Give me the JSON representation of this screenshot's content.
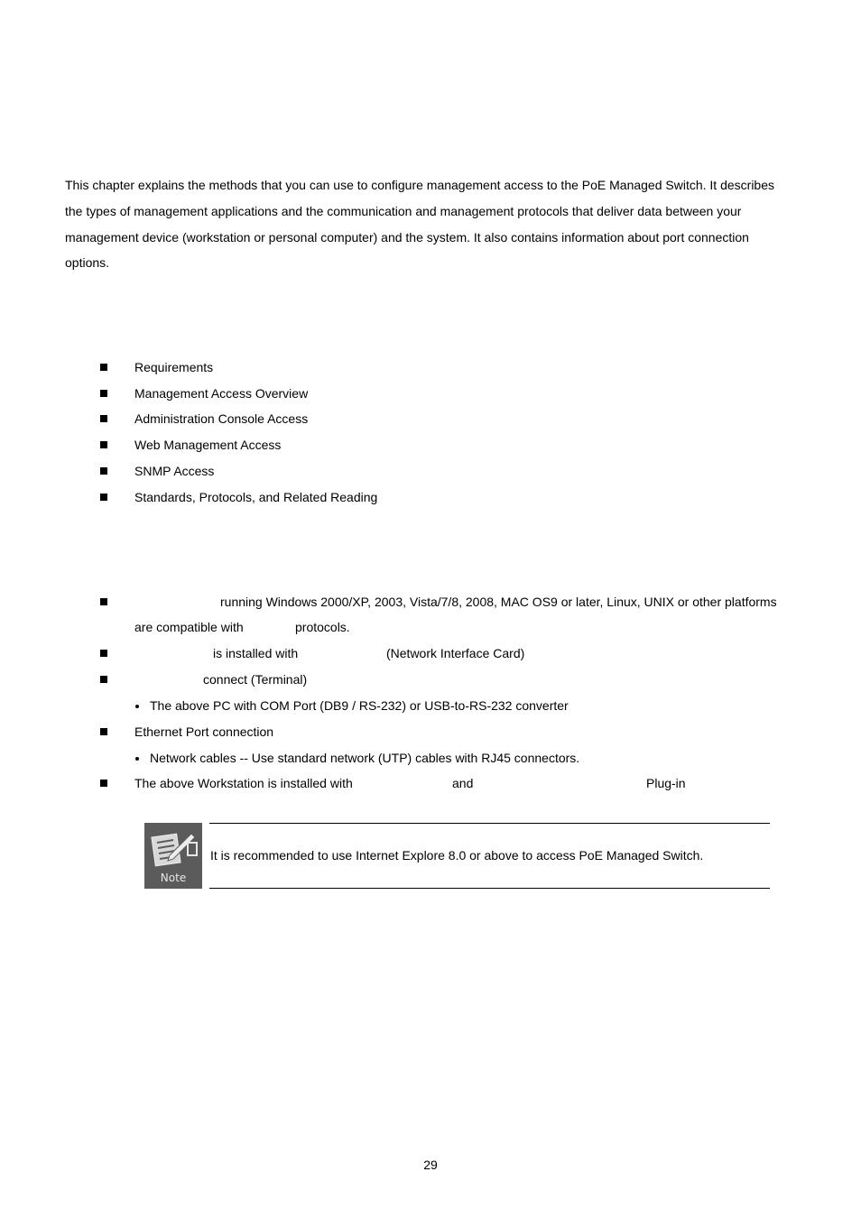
{
  "intro": {
    "lines": [
      "This chapter explains the methods that you can use to configure management access to the PoE Managed Switch. It describes",
      "the types of management applications and the communication and management protocols that deliver data between your",
      "management device (workstation or personal computer) and the system. It also contains information about port connection",
      "options."
    ]
  },
  "topics": {
    "items": [
      "Requirements",
      "Management Access Overview",
      "Administration Console Access",
      "Web Management Access",
      "SNMP Access",
      "Standards, Protocols, and Related Reading"
    ]
  },
  "requirements": {
    "item1_line1": "running Windows 2000/XP, 2003, Vista/7/8, 2008, MAC OS9 or later, Linux, UNIX or other platforms",
    "item1_line2a": "are compatible with",
    "item1_line2b": "protocols.",
    "item2a": "is installed with",
    "item2b": "(Network Interface Card)",
    "item3": "connect (Terminal)",
    "item3_sub": "The above PC with COM Port (DB9 / RS-232) or USB-to-RS-232 converter",
    "item4": "Ethernet Port connection",
    "item4_sub": "Network cables -- Use standard network (UTP) cables with RJ45 connectors.",
    "item5a": "The above Workstation is installed with",
    "item5b": "and",
    "item5c": "Plug-in"
  },
  "note": {
    "icon": "note-pencil-icon",
    "icon_label": "Note",
    "text": "It is recommended to use Internet Explore 8.0 or above to access PoE Managed Switch."
  },
  "footer": {
    "page_number": "29"
  }
}
